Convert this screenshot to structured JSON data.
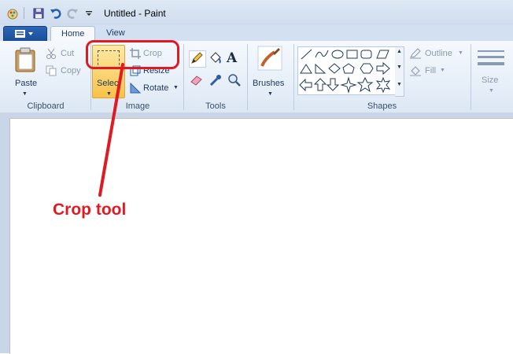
{
  "window": {
    "title": "Untitled - Paint"
  },
  "tabs": [
    {
      "label": "Home",
      "active": true
    },
    {
      "label": "View",
      "active": false
    }
  ],
  "clipboard": {
    "paste": "Paste",
    "cut": "Cut",
    "copy": "Copy",
    "group_label": "Clipboard"
  },
  "image": {
    "select": "Select",
    "crop": "Crop",
    "resize": "Resize",
    "rotate": "Rotate",
    "group_label": "Image"
  },
  "tools": {
    "group_label": "Tools"
  },
  "brushes": {
    "label": "Brushes"
  },
  "shapes": {
    "outline": "Outline",
    "fill": "Fill",
    "group_label": "Shapes"
  },
  "size": {
    "label": "Size"
  },
  "annotation": {
    "text": "Crop tool",
    "color": "#e01a22"
  },
  "colors": {
    "accent": "#1a4e98",
    "select_highlight": "#fbd35f"
  }
}
